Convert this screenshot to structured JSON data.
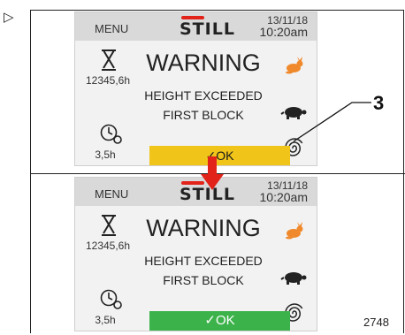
{
  "marker": "▷",
  "callout_number": "3",
  "figure_number": "2748",
  "screens": [
    {
      "menu": "MENU",
      "logo": "STILL",
      "date": "13/11/18",
      "time": "10:20am",
      "operating_hours": "12345,6h",
      "timer_hours": "3,5h",
      "warning_title": "WARNING",
      "message_line1": "HEIGHT EXCEEDED",
      "message_line2": "FIRST BLOCK",
      "ok_label": "✓OK",
      "ok_color": "#f0c419"
    },
    {
      "menu": "MENU",
      "logo": "STILL",
      "date": "13/11/18",
      "time": "10:20am",
      "operating_hours": "12345,6h",
      "timer_hours": "3,5h",
      "warning_title": "WARNING",
      "message_line1": "HEIGHT EXCEEDED",
      "message_line2": "FIRST BLOCK",
      "ok_label": "✓OK",
      "ok_color": "#3cb34a"
    }
  ],
  "icons": {
    "left_top": "hourglass-icon",
    "left_bottom": "clock-settings-icon",
    "right_top": "rabbit-icon",
    "right_middle": "turtle-icon",
    "right_bottom": "spiral-icon"
  },
  "colors": {
    "accent_red": "#e2231a",
    "rabbit_orange": "#f0892b",
    "ok_yellow": "#f0c419",
    "ok_green": "#3cb34a"
  }
}
